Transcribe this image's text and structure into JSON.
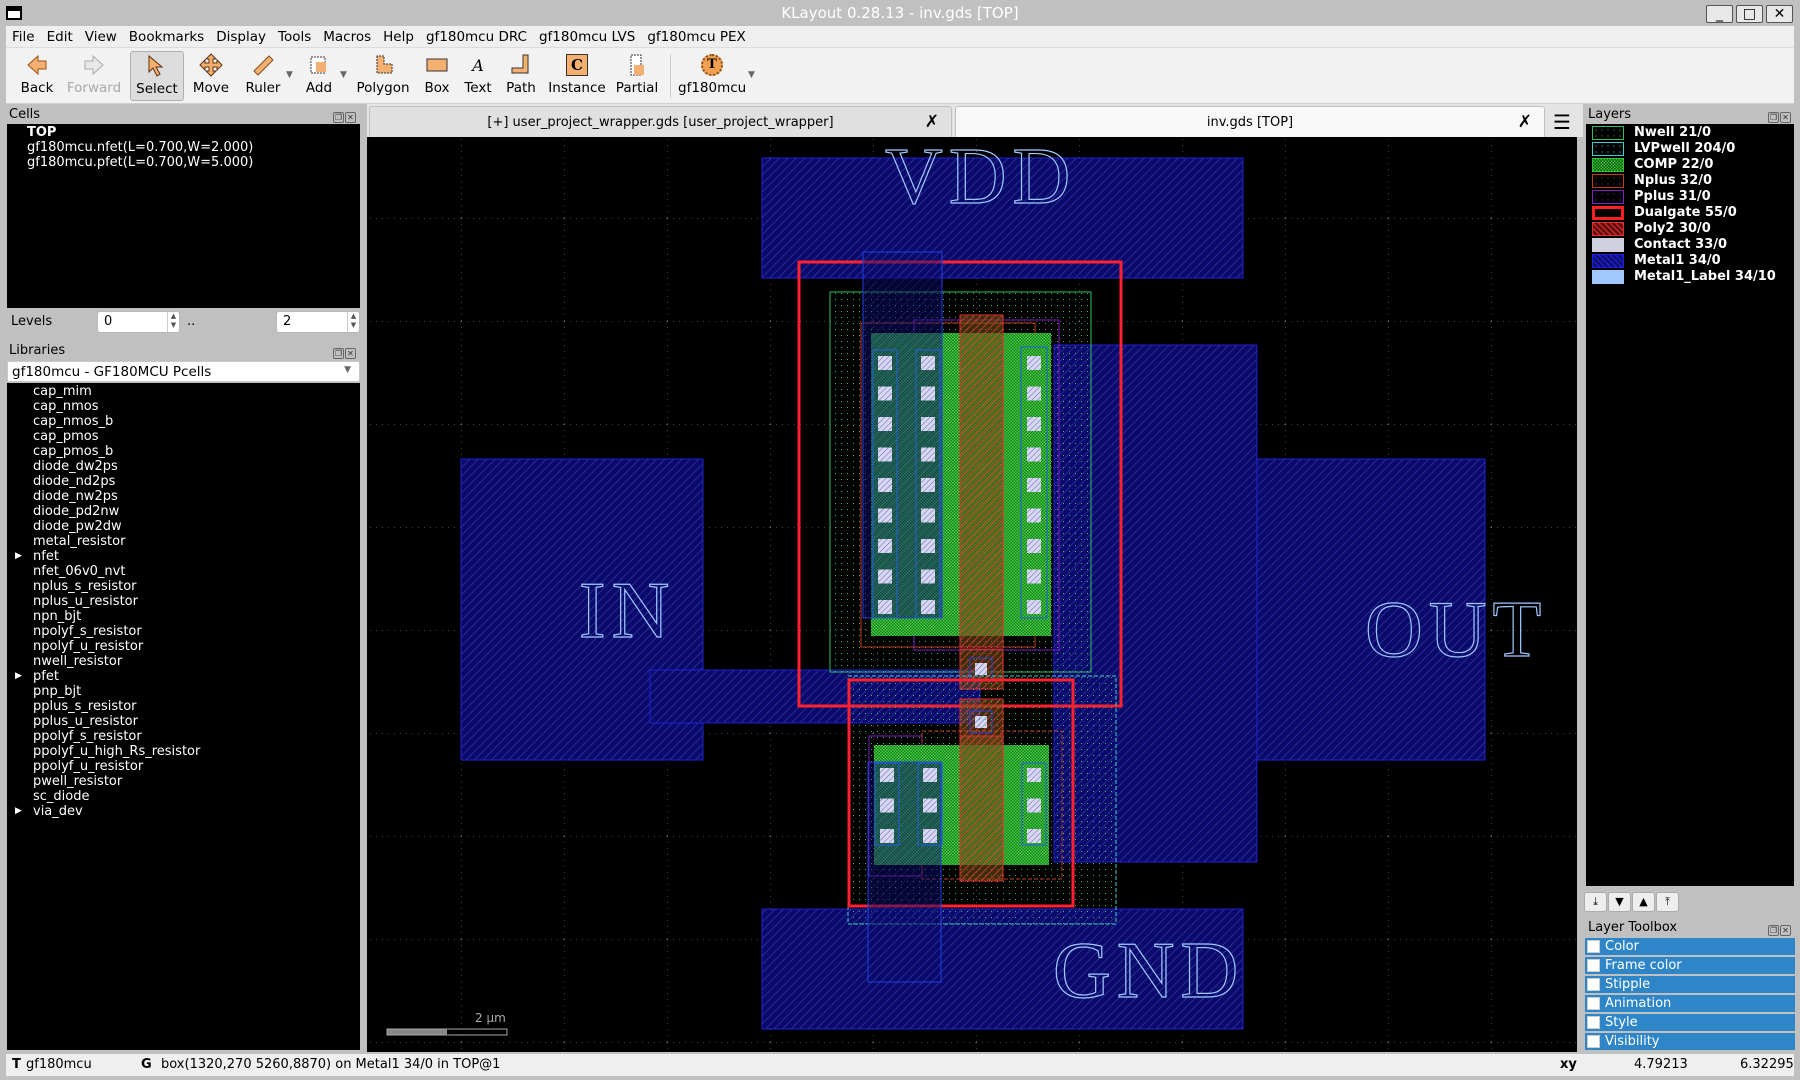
{
  "window": {
    "title": "KLayout 0.28.13 - inv.gds [TOP]",
    "controls": {
      "minimize": "_",
      "maximize": "□",
      "close": "✕"
    }
  },
  "menubar": [
    "File",
    "Edit",
    "View",
    "Bookmarks",
    "Display",
    "Tools",
    "Macros",
    "Help",
    "gf180mcu DRC",
    "gf180mcu LVS",
    "gf180mcu PEX"
  ],
  "toolbar": {
    "back": "Back",
    "forward": "Forward",
    "select": "Select",
    "move": "Move",
    "ruler": "Ruler",
    "add": "Add",
    "polygon": "Polygon",
    "box": "Box",
    "text": "Text",
    "path": "Path",
    "instance": "Instance",
    "partial": "Partial",
    "tech": "gf180mcu"
  },
  "cells": {
    "title": "Cells",
    "items": [
      "TOP",
      "gf180mcu.nfet(L=0.700,W=2.000)",
      "gf180mcu.pfet(L=0.700,W=5.000)"
    ],
    "levels_label": "Levels",
    "levels_from": "0",
    "levels_sep": "..",
    "levels_to": "2"
  },
  "libraries": {
    "title": "Libraries",
    "selected": "gf180mcu - GF180MCU Pcells",
    "items": [
      {
        "name": "cap_mim",
        "expandable": false
      },
      {
        "name": "cap_nmos",
        "expandable": false
      },
      {
        "name": "cap_nmos_b",
        "expandable": false
      },
      {
        "name": "cap_pmos",
        "expandable": false
      },
      {
        "name": "cap_pmos_b",
        "expandable": false
      },
      {
        "name": "diode_dw2ps",
        "expandable": false
      },
      {
        "name": "diode_nd2ps",
        "expandable": false
      },
      {
        "name": "diode_nw2ps",
        "expandable": false
      },
      {
        "name": "diode_pd2nw",
        "expandable": false
      },
      {
        "name": "diode_pw2dw",
        "expandable": false
      },
      {
        "name": "metal_resistor",
        "expandable": false
      },
      {
        "name": "nfet",
        "expandable": true
      },
      {
        "name": "nfet_06v0_nvt",
        "expandable": false
      },
      {
        "name": "nplus_s_resistor",
        "expandable": false
      },
      {
        "name": "nplus_u_resistor",
        "expandable": false
      },
      {
        "name": "npn_bjt",
        "expandable": false
      },
      {
        "name": "npolyf_s_resistor",
        "expandable": false
      },
      {
        "name": "npolyf_u_resistor",
        "expandable": false
      },
      {
        "name": "nwell_resistor",
        "expandable": false
      },
      {
        "name": "pfet",
        "expandable": true
      },
      {
        "name": "pnp_bjt",
        "expandable": false
      },
      {
        "name": "pplus_s_resistor",
        "expandable": false
      },
      {
        "name": "pplus_u_resistor",
        "expandable": false
      },
      {
        "name": "ppolyf_s_resistor",
        "expandable": false
      },
      {
        "name": "ppolyf_u_high_Rs_resistor",
        "expandable": false
      },
      {
        "name": "ppolyf_u_resistor",
        "expandable": false
      },
      {
        "name": "pwell_resistor",
        "expandable": false
      },
      {
        "name": "sc_diode",
        "expandable": false
      },
      {
        "name": "via_dev",
        "expandable": true
      }
    ]
  },
  "tabs": [
    {
      "label": "[+] user_project_wrapper.gds [user_project_wrapper]",
      "active": false
    },
    {
      "label": "inv.gds [TOP]",
      "active": true
    }
  ],
  "canvas": {
    "labels": {
      "vdd": "VDD",
      "gnd": "GND",
      "in": "IN",
      "out": "OUT"
    },
    "scale_bar": "2 µm"
  },
  "layers": {
    "title": "Layers",
    "items": [
      {
        "name": "Nwell 21/0",
        "frame": "#30c060",
        "fill": "#000000",
        "pattern": "dots"
      },
      {
        "name": "LVPwell 204/0",
        "frame": "#40d0d0",
        "fill": "#000000",
        "pattern": "dots"
      },
      {
        "name": "COMP 22/0",
        "frame": "#30c030",
        "fill": "#30b030",
        "pattern": "check"
      },
      {
        "name": "Nplus 32/0",
        "frame": "#c04020",
        "fill": "#000000",
        "pattern": "dots"
      },
      {
        "name": "Pplus 31/0",
        "frame": "#8020c0",
        "fill": "#000000",
        "pattern": "dots"
      },
      {
        "name": "Dualgate 55/0",
        "frame": "#ff2020",
        "fill": "#000000",
        "pattern": "solid"
      },
      {
        "name": "Poly2 30/0",
        "frame": "#e03030",
        "fill": "#601010",
        "pattern": "hatch"
      },
      {
        "name": "Contact 33/0",
        "frame": "#d0d0e0",
        "fill": "#d0d0e0",
        "pattern": "solid"
      },
      {
        "name": "Metal1 34/0",
        "frame": "#2020e0",
        "fill": "#101070",
        "pattern": "hatch"
      },
      {
        "name": "Metal1_Label 34/10",
        "frame": "#a0c8ff",
        "fill": "#a0c8ff",
        "pattern": "solid"
      }
    ]
  },
  "layer_toolbox": {
    "title": "Layer Toolbox",
    "items": [
      "Color",
      "Frame color",
      "Stipple",
      "Animation",
      "Style",
      "Visibility"
    ]
  },
  "statusbar": {
    "tech_key": "T",
    "tech": "gf180mcu",
    "sel_key": "G",
    "selection": "box(1320,270 5260,8870) on Metal1 34/0 in TOP@1",
    "coord_label": "xy",
    "x": "4.79213",
    "y": "6.32295"
  },
  "colors": {
    "selection_blue": "#2e86c8",
    "canvas_bg": "#000000"
  }
}
